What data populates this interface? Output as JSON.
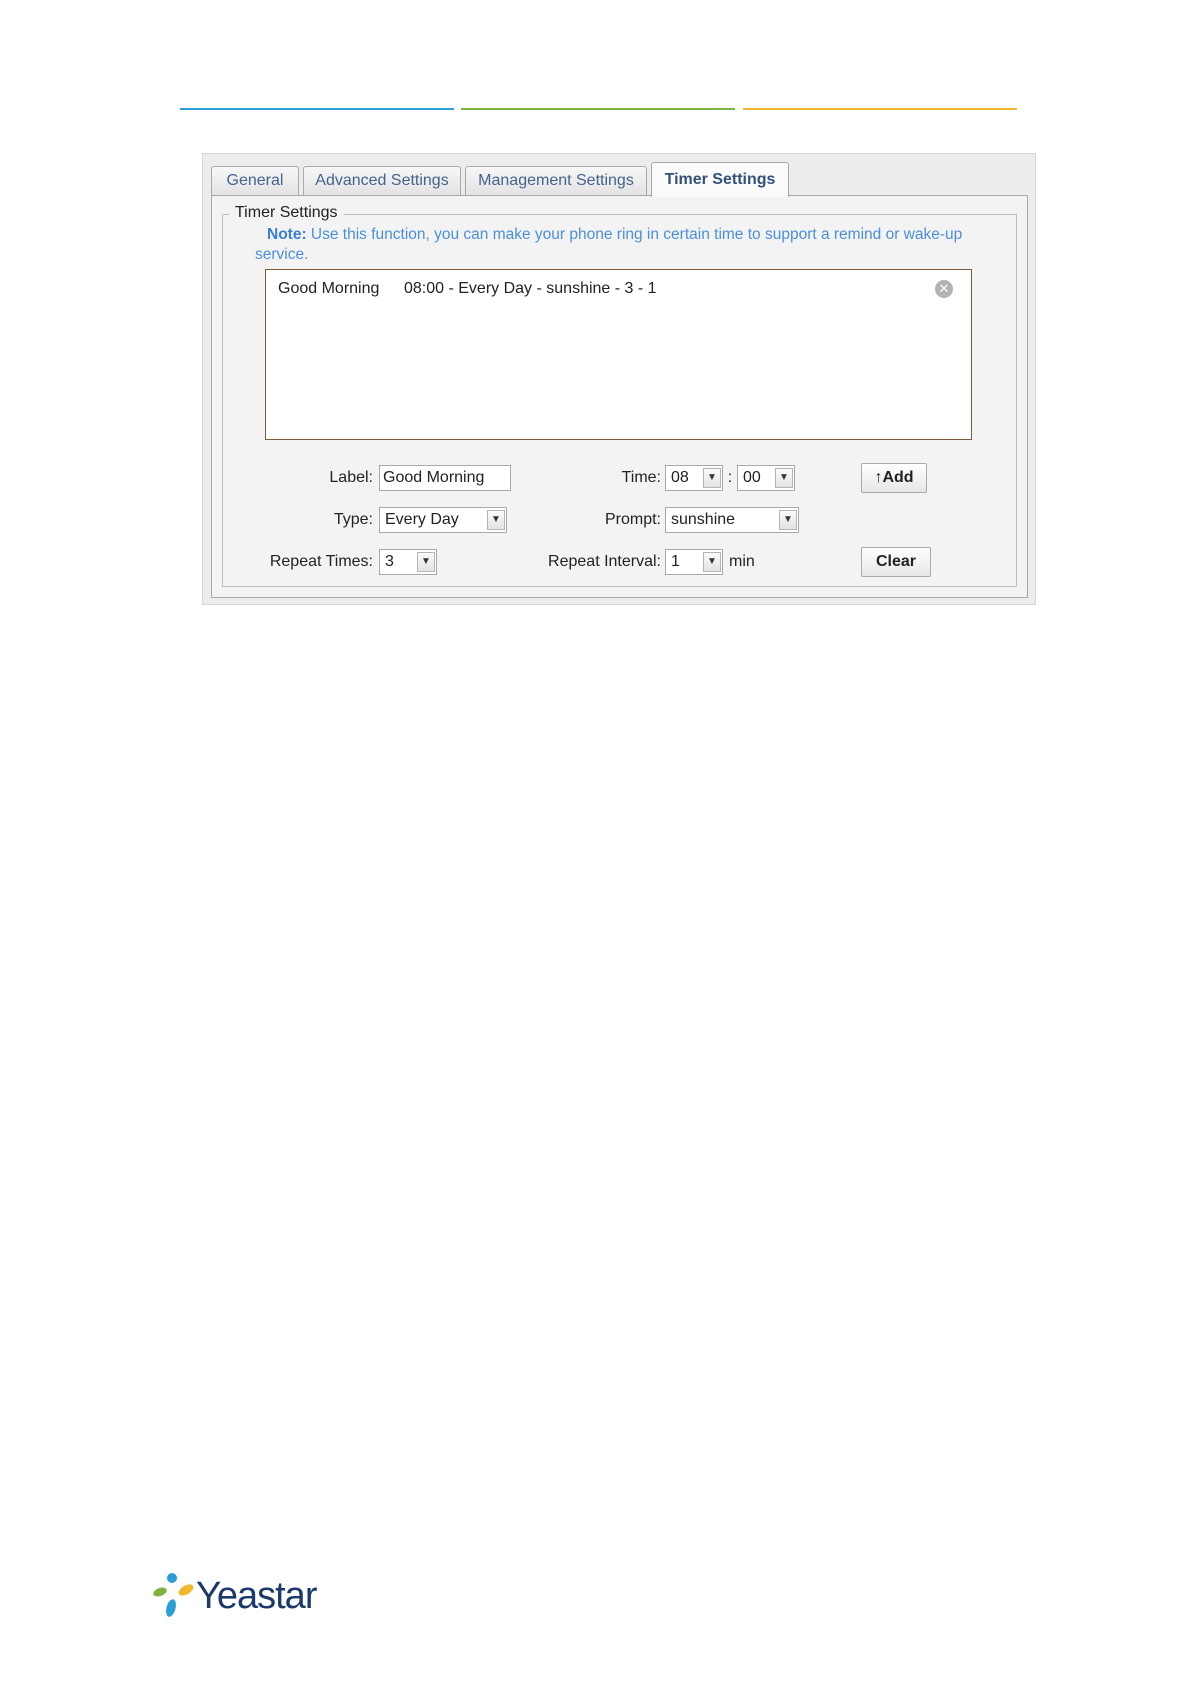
{
  "tabs": [
    {
      "label": "General",
      "active": false
    },
    {
      "label": "Advanced Settings",
      "active": false
    },
    {
      "label": "Management Settings",
      "active": false
    },
    {
      "label": "Timer Settings",
      "active": true
    }
  ],
  "section": {
    "legend": "Timer Settings",
    "note_head": "Note:",
    "note_text": " Use this function, you can make your phone ring in certain time to support a remind or wake-up service."
  },
  "timers": [
    {
      "label": "Good Morning",
      "detail": "08:00 - Every Day - sunshine - 3 - 1"
    }
  ],
  "form": {
    "label_label": "Label:",
    "label_value": "Good Morning",
    "time_label": "Time:",
    "time_hour": "08",
    "time_sep": ":",
    "time_minute": "00",
    "type_label": "Type:",
    "type_value": "Every Day",
    "prompt_label": "Prompt:",
    "prompt_value": "sunshine",
    "repeat_times_label": "Repeat Times:",
    "repeat_times_value": "3",
    "repeat_interval_label": "Repeat Interval:",
    "repeat_interval_value": "1",
    "repeat_interval_unit": "min",
    "add_button": "↑Add",
    "clear_button": "Clear"
  },
  "brand": {
    "name": "Yeastar",
    "colors": {
      "blue": "#2a9fd6",
      "green": "#7fb241",
      "yellow": "#f1b82d",
      "navy": "#1b3a6b"
    }
  }
}
